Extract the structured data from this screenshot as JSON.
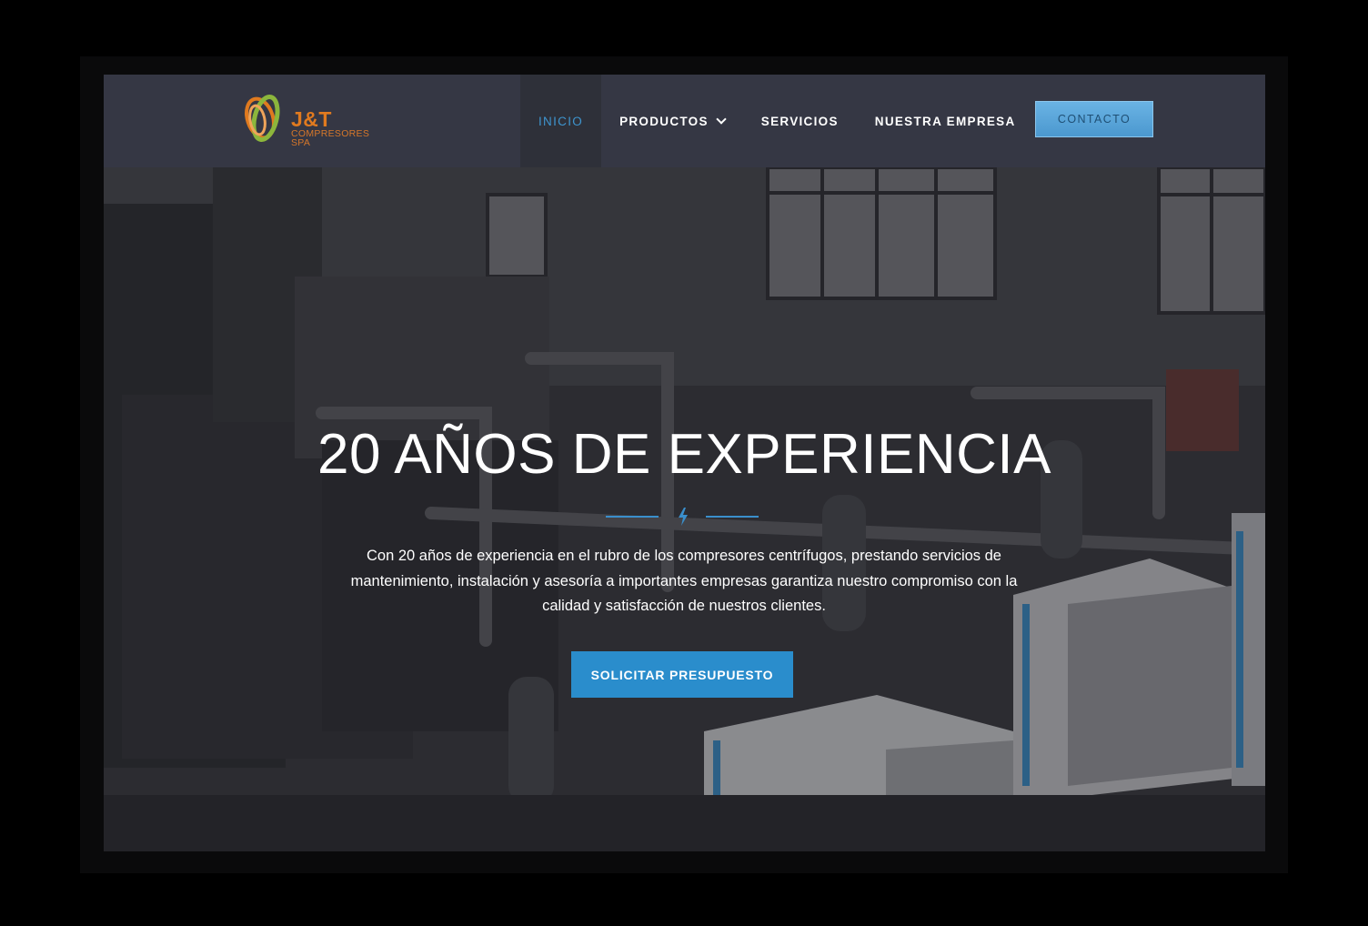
{
  "header": {
    "logo": {
      "main": "J&T",
      "sub_line1": "COMPRESORES",
      "sub_line2": "SPA"
    },
    "nav": [
      {
        "label": "INICIO",
        "active": true
      },
      {
        "label": "PRODUCTOS",
        "has_dropdown": true
      },
      {
        "label": "SERVICIOS"
      },
      {
        "label": "NUESTRA EMPRESA"
      }
    ],
    "contact_label": "CONTACTO"
  },
  "hero": {
    "title": "20 AÑOS DE EXPERIENCIA",
    "text": "Con 20 años de experiencia en el rubro de los compresores centrífugos, prestando servicios de mantenimiento, instalación y asesoría a importantes empresas garantiza nuestro compromiso con la calidad y satisfacción de nuestros clientes.",
    "cta_label": "SOLICITAR PRESUPUESTO",
    "background_image": "compressor-room-photo",
    "divider_icon": "lightning-bolt-icon"
  },
  "colors": {
    "header_bg": "#353744",
    "accent": "#2a8dcc",
    "active_nav": "#3e95cf",
    "logo_orange": "#e07a1f",
    "logo_green": "#8cb63c"
  }
}
